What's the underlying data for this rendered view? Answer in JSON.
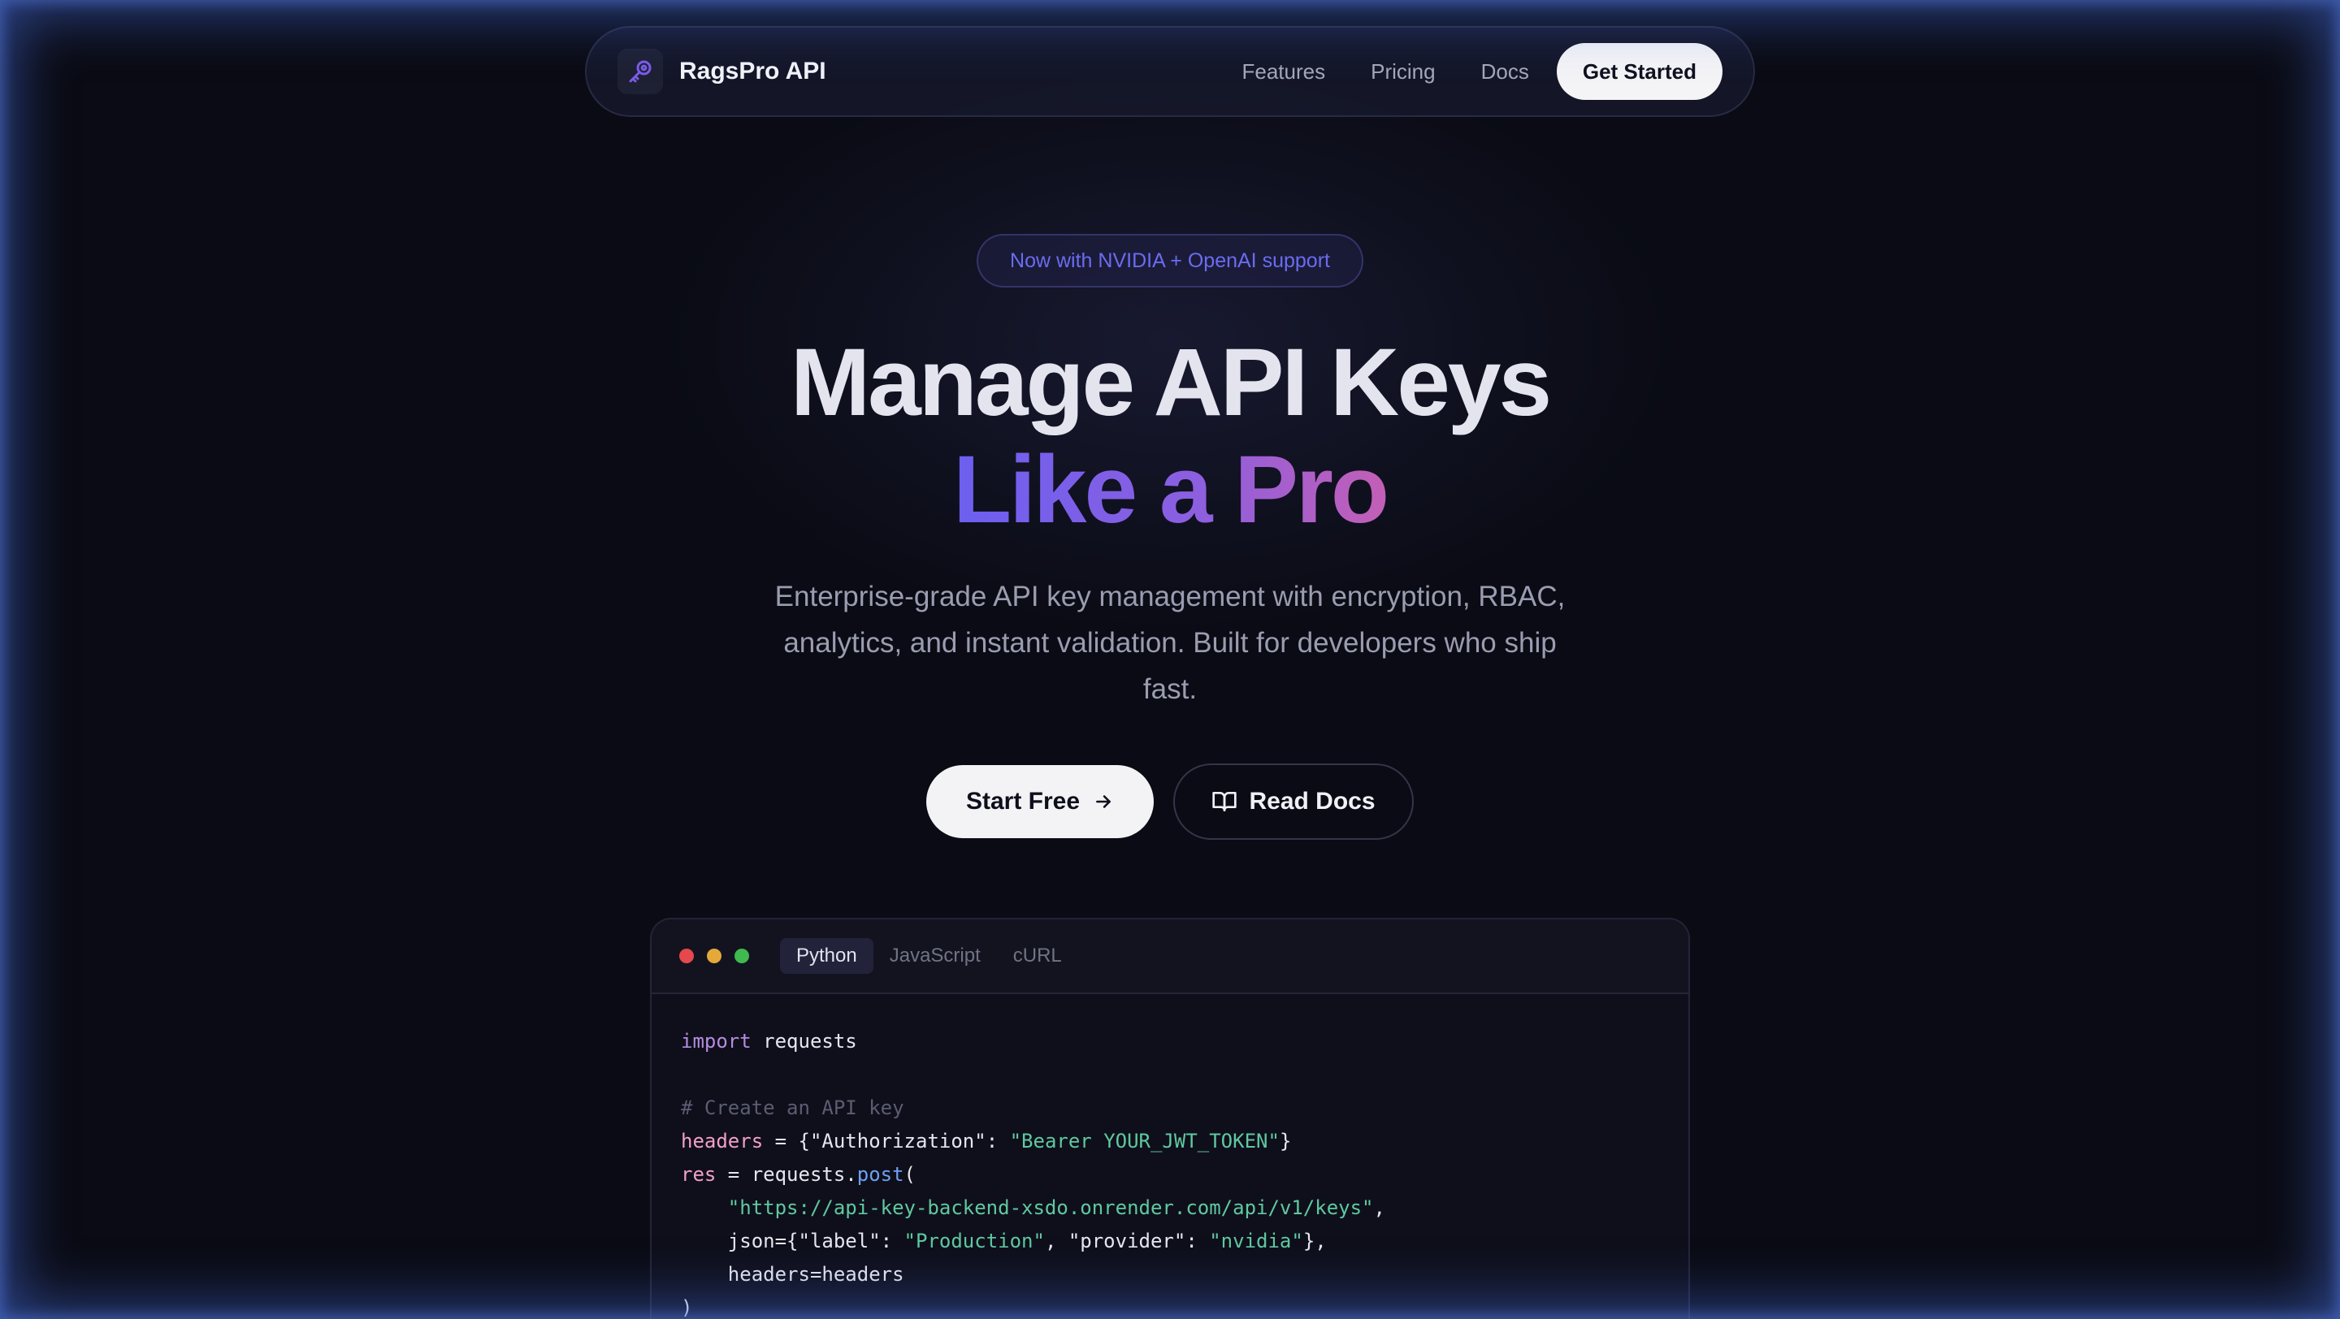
{
  "nav": {
    "brand": "RagsPro API",
    "links": [
      "Features",
      "Pricing",
      "Docs"
    ],
    "cta": "Get Started"
  },
  "hero": {
    "badge": "Now with NVIDIA + OpenAI support",
    "title_line1": "Manage API Keys",
    "title_line2": "Like a Pro",
    "subtitle_line1": "Enterprise-grade API key management with encryption, RBAC,",
    "subtitle_line2": "analytics, and instant validation. Built for developers who ship",
    "subtitle_line3": "fast.",
    "primary_button": "Start Free",
    "secondary_button": "Read Docs"
  },
  "code": {
    "tabs": [
      "Python",
      "JavaScript",
      "cURL"
    ],
    "active_tab": "Python",
    "tokens": {
      "l1_kw": "import",
      "l1_rest": " requests",
      "l3_comment": "# Create an API key",
      "l4_var": "headers",
      "l4_mid": " = {\"Authorization\": ",
      "l4_str": "\"Bearer YOUR_JWT_TOKEN\"",
      "l4_end": "}",
      "l5_var": "res",
      "l5_mid": " = requests.",
      "l5_fn": "post",
      "l5_end": "(",
      "l6_str": "\"https://api-key-backend-xsdo.onrender.com/api/v1/keys\"",
      "l6_end": ",",
      "l7_a": "json={\"label\": ",
      "l7_str1": "\"Production\"",
      "l7_b": ", \"provider\": ",
      "l7_str2": "\"nvidia\"",
      "l7_c": "},",
      "l8": "headers=headers",
      "l9": ")"
    }
  },
  "colors": {
    "background": "#0a0b14",
    "accent_purple": "#6c5ff0",
    "accent_pink": "#c35fb6",
    "window_red": "#e5484d",
    "window_yellow": "#e5a93a",
    "window_green": "#3fb950"
  },
  "icons": {
    "logo": "key-icon",
    "start_free": "arrow-right-icon",
    "read_docs": "book-open-icon"
  }
}
